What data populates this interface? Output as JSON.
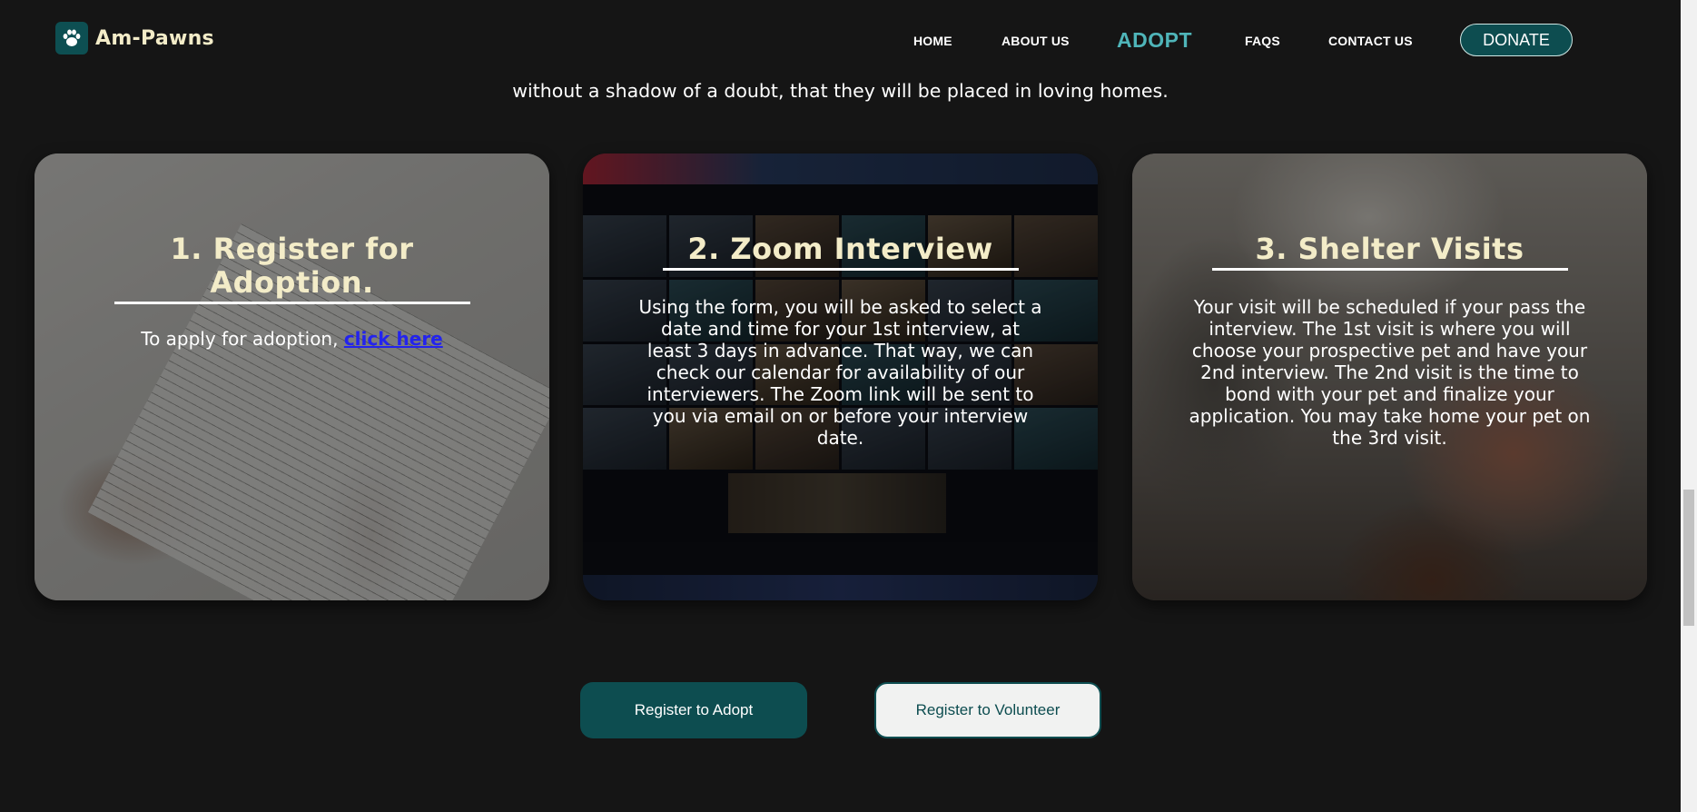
{
  "brand": {
    "name": "Am-Pawns",
    "logo_icon": "paw-icon",
    "accent": "#0d4d50",
    "highlight": "#4fb5b9",
    "title_color": "#f3ecc8"
  },
  "nav": {
    "home": "HOME",
    "about": "ABOUT US",
    "adopt": "ADOPT",
    "faqs": "FAQS",
    "contact": "CONTACT US",
    "donate": "DONATE",
    "active": "ADOPT"
  },
  "intro": {
    "text": "without a shadow of a doubt, that they will be placed in loving homes."
  },
  "cards": [
    {
      "title": "1. Register for Adoption.",
      "text": "To apply for adoption, ",
      "link": "click here",
      "link_color": "#2323ee"
    },
    {
      "title": "2. Zoom Interview",
      "text": "Using the form, you will be asked to select a date and time for your 1st interview, at least 3 days in advance. That way, we can check our calendar for availability of our interviewers. The Zoom link will be sent to you via email on or before your interview date."
    },
    {
      "title": "3. Shelter Visits",
      "text": "Your visit will be scheduled if your pass the interview. The 1st visit is where you will choose your prospective pet and have your 2nd interview. The 2nd visit is the time to bond with your pet and finalize your application. You may take home your pet on the 3rd visit."
    }
  ],
  "buttons": {
    "adopt": "Register to Adopt",
    "volunteer": "Register to Volunteer"
  }
}
